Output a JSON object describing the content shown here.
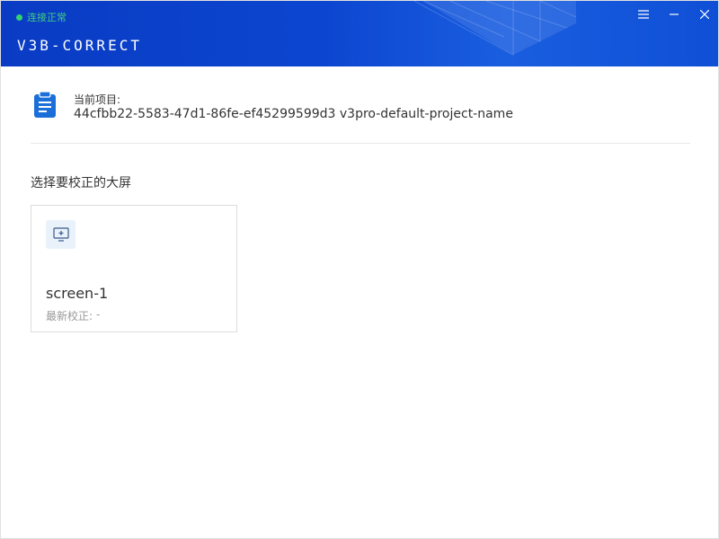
{
  "status": {
    "text": "连接正常",
    "color": "#35d36f"
  },
  "app": {
    "title": "V3B-CORRECT"
  },
  "window_controls": [
    {
      "name": "menu-icon"
    },
    {
      "name": "minimize-icon"
    },
    {
      "name": "close-icon"
    }
  ],
  "project": {
    "icon": "clipboard-icon",
    "label": "当前项目:",
    "value": "44cfbb22-5583-47d1-86fe-ef45299599d3 v3pro-default-project-name"
  },
  "section": {
    "title": "选择要校正的大屏"
  },
  "screens": [
    {
      "icon": "monitor-icon",
      "name": "screen-1",
      "latest_label": "最新校正:",
      "latest_value": "-"
    }
  ],
  "colors": {
    "header": "#0c46d0",
    "accent": "#1a6fd9",
    "status_ok": "#35d36f"
  }
}
